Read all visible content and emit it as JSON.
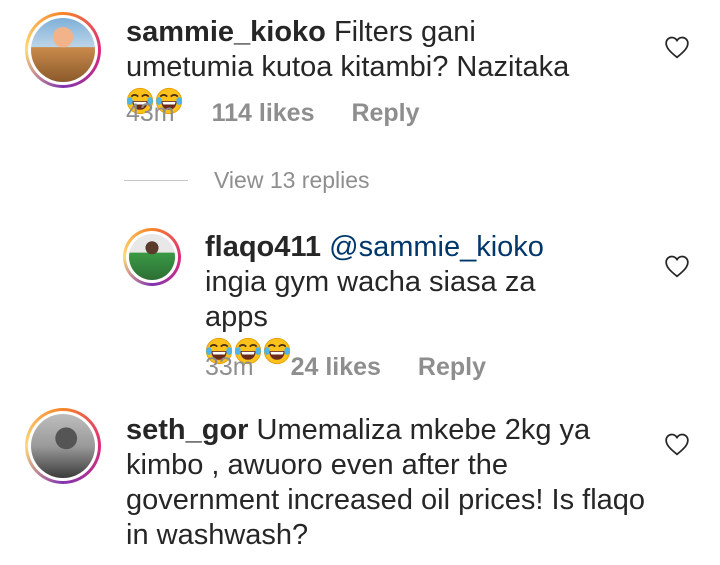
{
  "comments": [
    {
      "username": "sammie_kioko",
      "text": "Filters gani umetumia kutoa kitambi? Nazitaka",
      "emoji_count": 2,
      "time": "43m",
      "likes": "114 likes",
      "reply": "Reply"
    },
    {
      "username": "flaqo411",
      "mention": "@sammie_kioko",
      "text": "ingia gym wacha siasa za apps",
      "emoji_count": 3,
      "time": "33m",
      "likes": "24 likes",
      "reply": "Reply"
    },
    {
      "username": "seth_gor",
      "text": "Umemaliza mkebe 2kg ya kimbo , awuoro even after the government increased oil prices! Is flaqo in washwash?"
    }
  ],
  "view_replies": "View 13 replies",
  "colors": {
    "text": "#262626",
    "meta": "#8e8e8e",
    "mention": "#00376b"
  }
}
